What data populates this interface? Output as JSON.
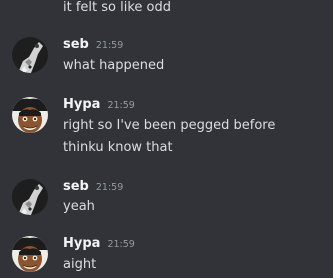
{
  "messages": [
    {
      "author": "",
      "timestamp": "",
      "lines": [
        "it felt so like odd"
      ]
    },
    {
      "author": "seb",
      "timestamp": "21:59",
      "avatar_icon": "seb-avatar-icon",
      "lines": [
        "what happened"
      ]
    },
    {
      "author": "Hypa",
      "timestamp": "21:59",
      "avatar_icon": "hypa-avatar-icon",
      "lines": [
        "right so I've been pegged before",
        "thinku know that"
      ]
    },
    {
      "author": "seb",
      "timestamp": "21:59",
      "avatar_icon": "seb-avatar-icon",
      "lines": [
        "yeah"
      ]
    },
    {
      "author": "Hypa",
      "timestamp": "21:59",
      "avatar_icon": "hypa-avatar-icon",
      "lines": [
        "aight"
      ]
    }
  ],
  "colors": {
    "background": "#313338",
    "text": "#dbdee1",
    "username": "#f2f3f5",
    "timestamp": "#949ba4"
  }
}
